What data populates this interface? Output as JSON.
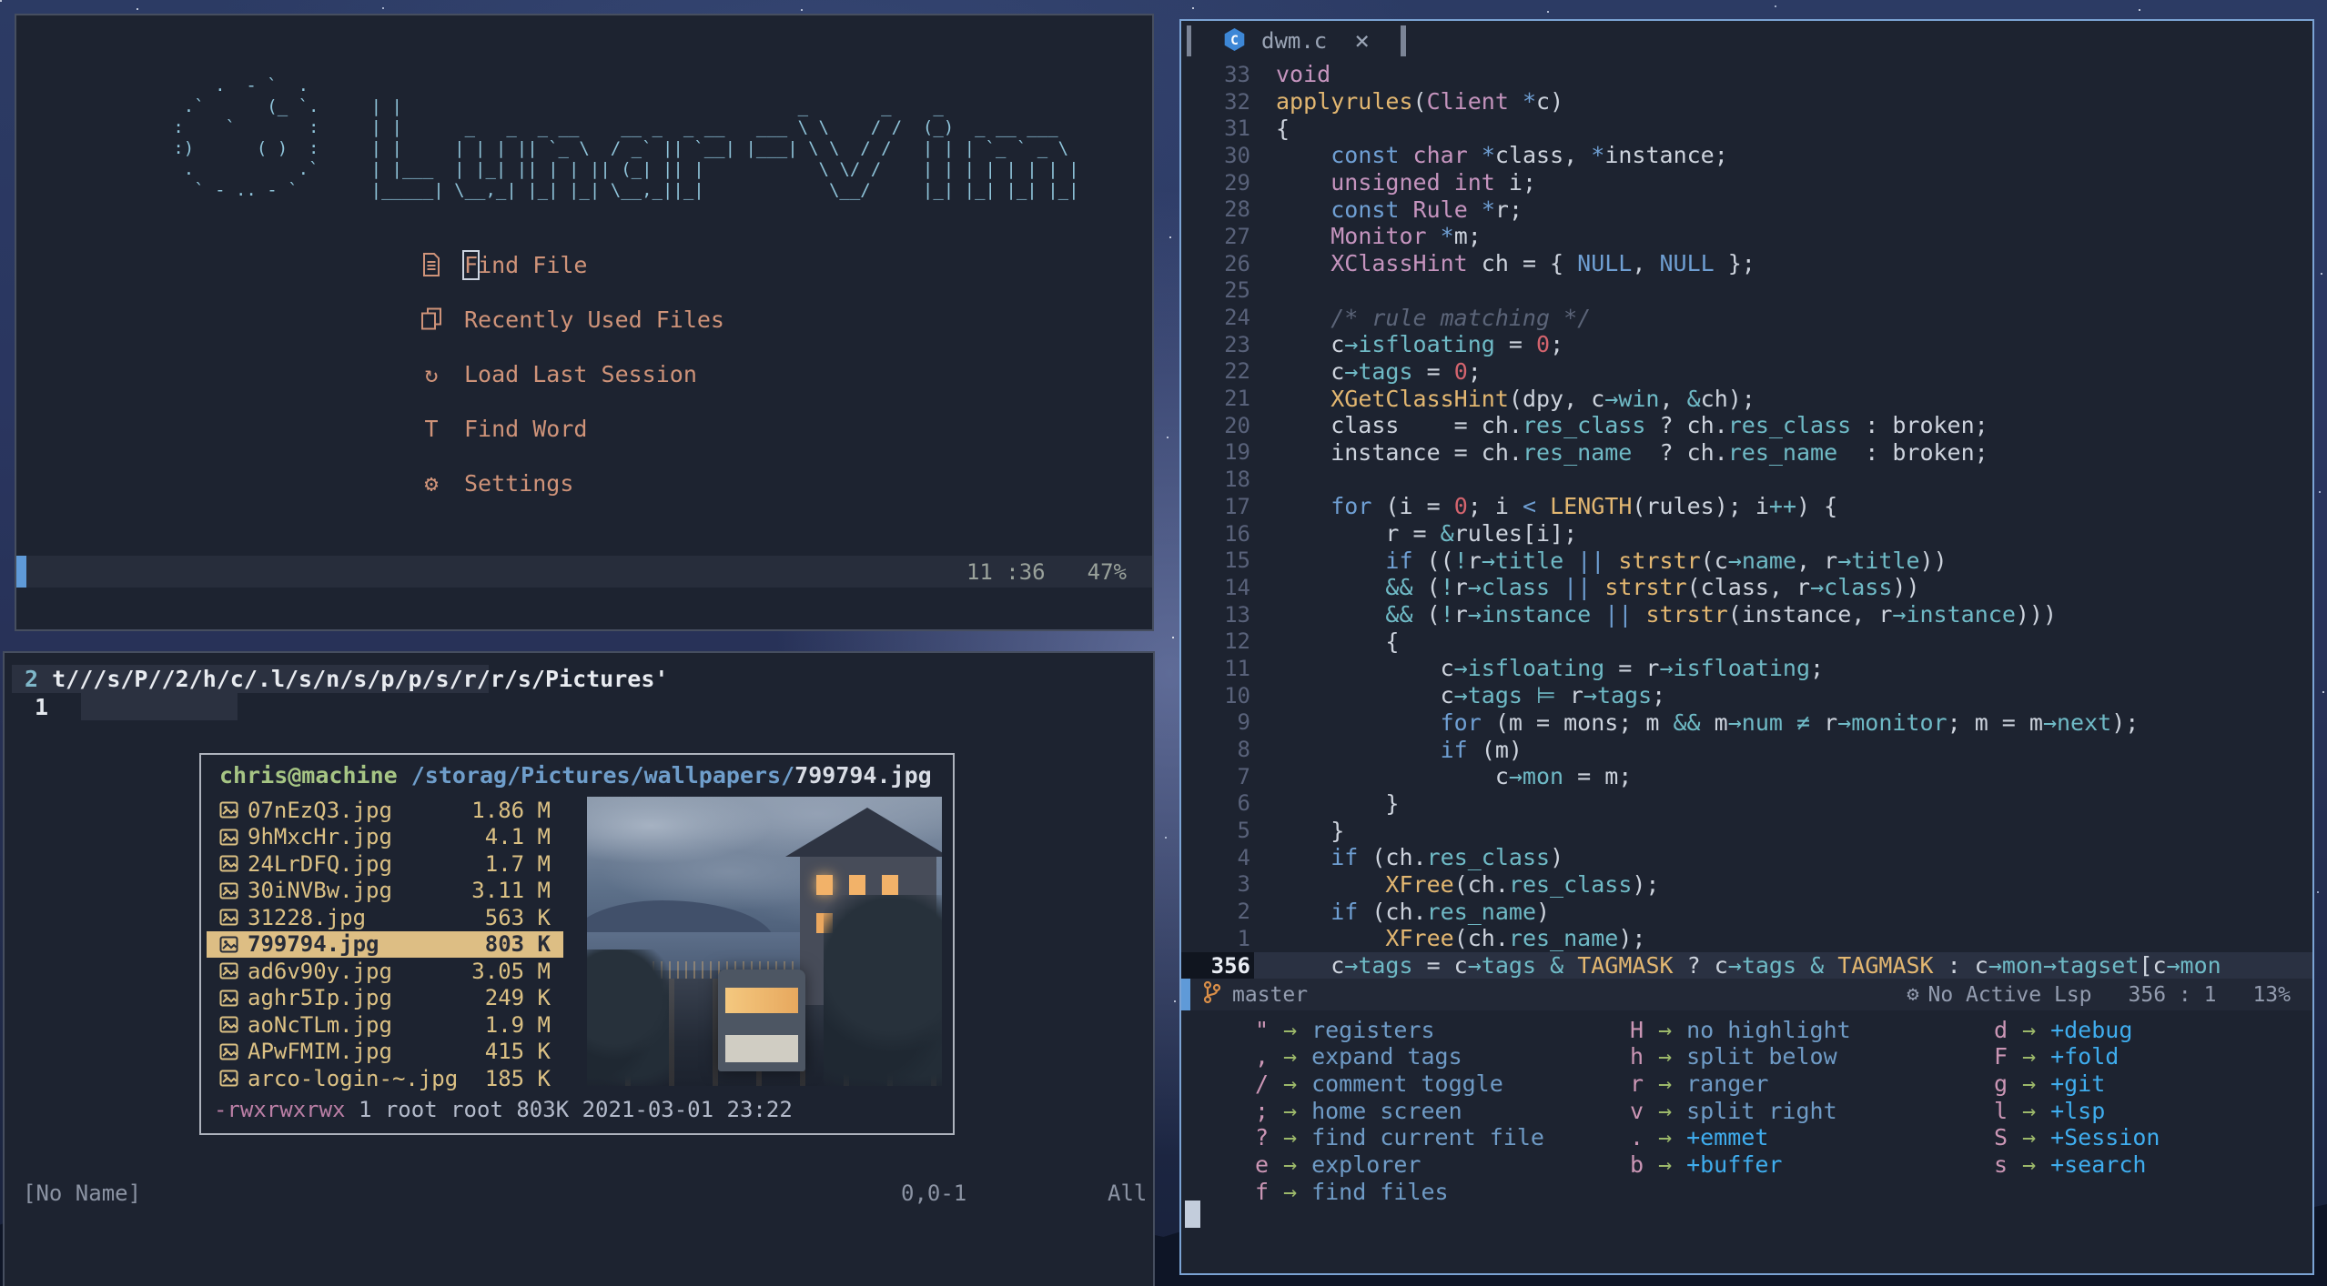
{
  "colors": {
    "window_bg": "#1d2330",
    "focus_border": "#7ba3d4",
    "accent_blue": "#5f9ad8",
    "menu_orange": "#cf9379",
    "logo_blue": "#8fc4da",
    "selection_tan": "#ddbe84",
    "file_tan": "#dcc184",
    "branch_orange": "#d98e48",
    "group_cyan": "#3fadee"
  },
  "dashboard": {
    "art": [
      "       .  - `  .",
      "    .`      (_ `.     | |                                      _       _    _",
      "   :    `       :     | |      _   _  _ __    __ _  _ __   ___ \\ \\    / /  (_)  _ __ ___",
      "   :)      ( )  :     | |     | | | || `_ \\  / _` || `__| |___| \\ \\  / /   | | | `_ ` _ \\",
      "    .          .`     | |___  | |_| || | | || (_| || |           \\ \\/ /    | | | | | | | |",
      "     ` - .. - `       |_____| \\__,_| |_| |_| \\__,_||_|            \\__/     |_| |_| |_| |_|"
    ],
    "menu": [
      {
        "icon": "file",
        "label": "Find File",
        "cursor": true
      },
      {
        "icon": "recent",
        "label": "Recently Used Files"
      },
      {
        "icon": "session",
        "label": "Load Last Session"
      },
      {
        "icon": "word",
        "label": "Find Word"
      },
      {
        "icon": "settings",
        "label": "Settings"
      }
    ],
    "statusline": {
      "position": "11 :36",
      "percent": "47%"
    }
  },
  "terminal": {
    "cmdline": {
      "number": "2",
      "text": "t///s/P//2/h/c/.l/s/n/s/p/p/s/r/r/s/Pictures'"
    },
    "line2_number": "1",
    "panel": {
      "user": "chris@machine",
      "path": " /storag/Pictures/wallpapers/",
      "file": "799794.jpg",
      "files": [
        {
          "name": "07nEzQ3.jpg",
          "size": "1.86 M"
        },
        {
          "name": "9hMxcHr.jpg",
          "size": "4.1 M"
        },
        {
          "name": "24LrDFQ.jpg",
          "size": "1.7 M"
        },
        {
          "name": "30iNVBw.jpg",
          "size": "3.11 M"
        },
        {
          "name": "31228.jpg",
          "size": "563 K"
        },
        {
          "name": "799794.jpg",
          "size": "803 K",
          "selected": true
        },
        {
          "name": "ad6v90y.jpg",
          "size": "3.05 M"
        },
        {
          "name": "aghr5Ip.jpg",
          "size": "249 K"
        },
        {
          "name": "aoNcTLm.jpg",
          "size": "1.9 M"
        },
        {
          "name": "APwFMIM.jpg",
          "size": "415 K"
        },
        {
          "name": "arco-login-~.jpg",
          "size": "185 K"
        }
      ],
      "perm": "-rwxrwxrwx",
      "perm_rest": " 1 root root 803K 2021-03-01 23:22"
    },
    "statusline": {
      "name": "[No Name]",
      "pos": "0,0-1",
      "all": "All"
    }
  },
  "editor": {
    "tab": {
      "title": "dwm.c",
      "close": "×"
    },
    "statusline": {
      "branch": "master",
      "lsp": "No Active Lsp",
      "pos": "356 : 1",
      "percent": "13%"
    },
    "code": [
      {
        "n": "33",
        "s": [
          [
            "t",
            "void"
          ]
        ]
      },
      {
        "n": "32",
        "s": [
          [
            "f",
            "applyrules"
          ],
          [
            "d",
            "("
          ],
          [
            "t",
            "Client"
          ],
          [
            "d",
            " "
          ],
          [
            "b",
            "*"
          ],
          [
            "d",
            "c)"
          ]
        ]
      },
      {
        "n": "31",
        "s": [
          [
            "d",
            "{"
          ]
        ]
      },
      {
        "n": "30",
        "s": [
          [
            "d",
            "    "
          ],
          [
            "k",
            "const"
          ],
          [
            "d",
            " "
          ],
          [
            "t",
            "char"
          ],
          [
            "d",
            " "
          ],
          [
            "b",
            "*"
          ],
          [
            "d",
            "class, "
          ],
          [
            "b",
            "*"
          ],
          [
            "d",
            "instance;"
          ]
        ]
      },
      {
        "n": "29",
        "s": [
          [
            "d",
            "    "
          ],
          [
            "t",
            "unsigned"
          ],
          [
            "d",
            " "
          ],
          [
            "t",
            "int"
          ],
          [
            "d",
            " i;"
          ]
        ]
      },
      {
        "n": "28",
        "s": [
          [
            "d",
            "    "
          ],
          [
            "k",
            "const"
          ],
          [
            "d",
            " "
          ],
          [
            "t",
            "Rule"
          ],
          [
            "d",
            " "
          ],
          [
            "b",
            "*"
          ],
          [
            "d",
            "r;"
          ]
        ]
      },
      {
        "n": "27",
        "s": [
          [
            "d",
            "    "
          ],
          [
            "t",
            "Monitor"
          ],
          [
            "d",
            " "
          ],
          [
            "b",
            "*"
          ],
          [
            "d",
            "m;"
          ]
        ]
      },
      {
        "n": "26",
        "s": [
          [
            "d",
            "    "
          ],
          [
            "t",
            "XClassHint"
          ],
          [
            "d",
            " ch = { "
          ],
          [
            "k",
            "NULL"
          ],
          [
            "d",
            ", "
          ],
          [
            "k",
            "NULL"
          ],
          [
            "d",
            " };"
          ]
        ]
      },
      {
        "n": "25",
        "s": []
      },
      {
        "n": "24",
        "s": [
          [
            "d",
            "    "
          ],
          [
            "c",
            "/* rule matching */"
          ]
        ]
      },
      {
        "n": "23",
        "s": [
          [
            "d",
            "    c"
          ],
          [
            "m",
            "→isfloating"
          ],
          [
            "d",
            " = "
          ],
          [
            "n",
            "0"
          ],
          [
            "d",
            ";"
          ]
        ]
      },
      {
        "n": "22",
        "s": [
          [
            "d",
            "    c"
          ],
          [
            "m",
            "→tags"
          ],
          [
            "d",
            " = "
          ],
          [
            "n",
            "0"
          ],
          [
            "d",
            ";"
          ]
        ]
      },
      {
        "n": "21",
        "s": [
          [
            "d",
            "    "
          ],
          [
            "f",
            "XGetClassHint"
          ],
          [
            "d",
            "(dpy, c"
          ],
          [
            "m",
            "→win"
          ],
          [
            "d",
            ", "
          ],
          [
            "o",
            "&"
          ],
          [
            "d",
            "ch);"
          ]
        ]
      },
      {
        "n": "20",
        "s": [
          [
            "d",
            "    class    = ch."
          ],
          [
            "m",
            "res_class"
          ],
          [
            "d",
            " ? ch."
          ],
          [
            "m",
            "res_class"
          ],
          [
            "d",
            " : broken;"
          ]
        ]
      },
      {
        "n": "19",
        "s": [
          [
            "d",
            "    instance = ch."
          ],
          [
            "m",
            "res_name"
          ],
          [
            "d",
            "  ? ch."
          ],
          [
            "m",
            "res_name"
          ],
          [
            "d",
            "  : broken;"
          ]
        ]
      },
      {
        "n": "18",
        "s": []
      },
      {
        "n": "17",
        "s": [
          [
            "d",
            "    "
          ],
          [
            "k",
            "for"
          ],
          [
            "d",
            " (i = "
          ],
          [
            "n",
            "0"
          ],
          [
            "d",
            "; i "
          ],
          [
            "b",
            "<"
          ],
          [
            "d",
            " "
          ],
          [
            "f",
            "LENGTH"
          ],
          [
            "d",
            "(rules); i"
          ],
          [
            "o",
            "++"
          ],
          [
            "d",
            ") {"
          ]
        ]
      },
      {
        "n": "16",
        "s": [
          [
            "d",
            "        r = "
          ],
          [
            "o",
            "&"
          ],
          [
            "d",
            "rules[i];"
          ]
        ]
      },
      {
        "n": "15",
        "s": [
          [
            "d",
            "        "
          ],
          [
            "k",
            "if"
          ],
          [
            "d",
            " (("
          ],
          [
            "o",
            "!"
          ],
          [
            "d",
            "r"
          ],
          [
            "m",
            "→title"
          ],
          [
            "d",
            " "
          ],
          [
            "b",
            "||"
          ],
          [
            "d",
            " "
          ],
          [
            "f",
            "strstr"
          ],
          [
            "d",
            "(c"
          ],
          [
            "m",
            "→name"
          ],
          [
            "d",
            ", r"
          ],
          [
            "m",
            "→title"
          ],
          [
            "d",
            "))"
          ]
        ]
      },
      {
        "n": "14",
        "s": [
          [
            "d",
            "        "
          ],
          [
            "o",
            "&&"
          ],
          [
            "d",
            " ("
          ],
          [
            "o",
            "!"
          ],
          [
            "d",
            "r"
          ],
          [
            "m",
            "→class"
          ],
          [
            "d",
            " "
          ],
          [
            "b",
            "||"
          ],
          [
            "d",
            " "
          ],
          [
            "f",
            "strstr"
          ],
          [
            "d",
            "(class, r"
          ],
          [
            "m",
            "→class"
          ],
          [
            "d",
            "))"
          ]
        ]
      },
      {
        "n": "13",
        "s": [
          [
            "d",
            "        "
          ],
          [
            "o",
            "&&"
          ],
          [
            "d",
            " ("
          ],
          [
            "o",
            "!"
          ],
          [
            "d",
            "r"
          ],
          [
            "m",
            "→instance"
          ],
          [
            "d",
            " "
          ],
          [
            "b",
            "||"
          ],
          [
            "d",
            " "
          ],
          [
            "f",
            "strstr"
          ],
          [
            "d",
            "(instance, r"
          ],
          [
            "m",
            "→instance"
          ],
          [
            "d",
            ")))"
          ]
        ]
      },
      {
        "n": "12",
        "s": [
          [
            "d",
            "        {"
          ]
        ]
      },
      {
        "n": "11",
        "s": [
          [
            "d",
            "            c"
          ],
          [
            "m",
            "→isfloating"
          ],
          [
            "d",
            " = r"
          ],
          [
            "m",
            "→isfloating"
          ],
          [
            "d",
            ";"
          ]
        ]
      },
      {
        "n": "10",
        "s": [
          [
            "d",
            "            c"
          ],
          [
            "m",
            "→tags"
          ],
          [
            "d",
            " "
          ],
          [
            "o",
            "⊨"
          ],
          [
            "d",
            " r"
          ],
          [
            "m",
            "→tags"
          ],
          [
            "d",
            ";"
          ]
        ]
      },
      {
        "n": "9",
        "s": [
          [
            "d",
            "            "
          ],
          [
            "k",
            "for"
          ],
          [
            "d",
            " (m = mons; m "
          ],
          [
            "o",
            "&&"
          ],
          [
            "d",
            " m"
          ],
          [
            "m",
            "→num"
          ],
          [
            "d",
            " "
          ],
          [
            "o",
            "≠"
          ],
          [
            "d",
            " r"
          ],
          [
            "m",
            "→monitor"
          ],
          [
            "d",
            "; m = m"
          ],
          [
            "m",
            "→next"
          ],
          [
            "d",
            ");"
          ]
        ]
      },
      {
        "n": "8",
        "s": [
          [
            "d",
            "            "
          ],
          [
            "k",
            "if"
          ],
          [
            "d",
            " (m)"
          ]
        ]
      },
      {
        "n": "7",
        "s": [
          [
            "d",
            "                c"
          ],
          [
            "m",
            "→mon"
          ],
          [
            "d",
            " = m;"
          ]
        ]
      },
      {
        "n": "6",
        "s": [
          [
            "d",
            "        }"
          ]
        ]
      },
      {
        "n": "5",
        "s": [
          [
            "d",
            "    }"
          ]
        ]
      },
      {
        "n": "4",
        "s": [
          [
            "d",
            "    "
          ],
          [
            "k",
            "if"
          ],
          [
            "d",
            " (ch."
          ],
          [
            "m",
            "res_class"
          ],
          [
            "d",
            ")"
          ]
        ]
      },
      {
        "n": "3",
        "s": [
          [
            "d",
            "        "
          ],
          [
            "f",
            "XFree"
          ],
          [
            "d",
            "(ch."
          ],
          [
            "m",
            "res_class"
          ],
          [
            "d",
            ");"
          ]
        ]
      },
      {
        "n": "2",
        "s": [
          [
            "d",
            "    "
          ],
          [
            "k",
            "if"
          ],
          [
            "d",
            " (ch."
          ],
          [
            "m",
            "res_name"
          ],
          [
            "d",
            ")"
          ]
        ]
      },
      {
        "n": "1",
        "s": [
          [
            "d",
            "        "
          ],
          [
            "f",
            "XFree"
          ],
          [
            "d",
            "(ch."
          ],
          [
            "m",
            "res_name"
          ],
          [
            "d",
            ");"
          ]
        ]
      },
      {
        "n": "356",
        "cur": true,
        "s": [
          [
            "d",
            "    c"
          ],
          [
            "m",
            "→tags"
          ],
          [
            "d",
            " = c"
          ],
          [
            "m",
            "→tags"
          ],
          [
            "d",
            " "
          ],
          [
            "o",
            "&"
          ],
          [
            "d",
            " "
          ],
          [
            "f",
            "TAGMASK"
          ],
          [
            "d",
            " ? c"
          ],
          [
            "m",
            "→tags"
          ],
          [
            "d",
            " "
          ],
          [
            "o",
            "&"
          ],
          [
            "d",
            " "
          ],
          [
            "f",
            "TAGMASK"
          ],
          [
            "d",
            " : c"
          ],
          [
            "m",
            "→mon"
          ],
          [
            "m",
            "→tagset"
          ],
          [
            "d",
            "[c"
          ],
          [
            "m",
            "→mon"
          ]
        ]
      }
    ],
    "whichkey": {
      "columns": [
        [
          [
            "\"",
            "registers"
          ],
          [
            ",",
            "expand tags"
          ],
          [
            "/",
            "comment toggle"
          ],
          [
            ";",
            "home screen"
          ],
          [
            "?",
            "find current file"
          ],
          [
            "e",
            "explorer"
          ],
          [
            "f",
            "find files"
          ]
        ],
        [
          [
            "H",
            "no highlight"
          ],
          [
            "h",
            "split below"
          ],
          [
            "r",
            "ranger"
          ],
          [
            "v",
            "split right"
          ],
          [
            ".",
            "+emmet"
          ],
          [
            "b",
            "+buffer"
          ]
        ],
        [
          [
            "d",
            "+debug"
          ],
          [
            "F",
            "+fold"
          ],
          [
            "g",
            "+git"
          ],
          [
            "l",
            "+lsp"
          ],
          [
            "S",
            "+Session"
          ],
          [
            "s",
            "+search"
          ]
        ]
      ]
    }
  }
}
